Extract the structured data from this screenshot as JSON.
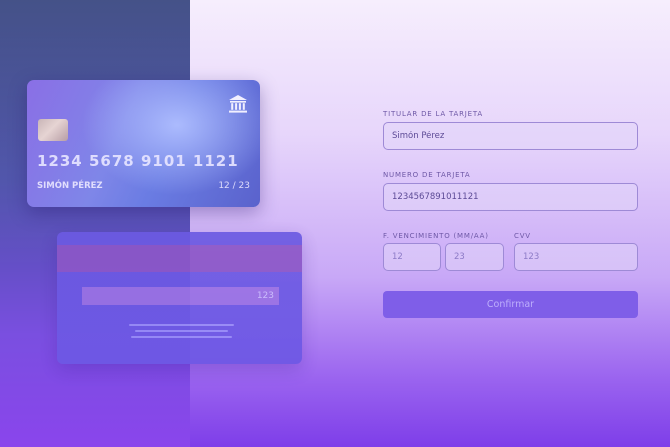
{
  "card_front": {
    "number": "1234 5678 9101 1121",
    "holder": "SIMÓN PÉREZ",
    "expiry": "12 / 23",
    "bank_icon": "bank-icon"
  },
  "card_back": {
    "cvv": "123"
  },
  "form": {
    "holder_label": "TITULAR DE LA TARJETA",
    "holder_value": "Simón Pérez",
    "number_label": "NUMERO DE TARJETA",
    "number_value": "1234567891011121",
    "expiry_label": "F. VENCIMIENTO (MM/AA)",
    "expiry_month": "12",
    "expiry_year": "23",
    "cvv_label": "CVV",
    "cvv_value": "123",
    "confirm_label": "Confirmar"
  }
}
